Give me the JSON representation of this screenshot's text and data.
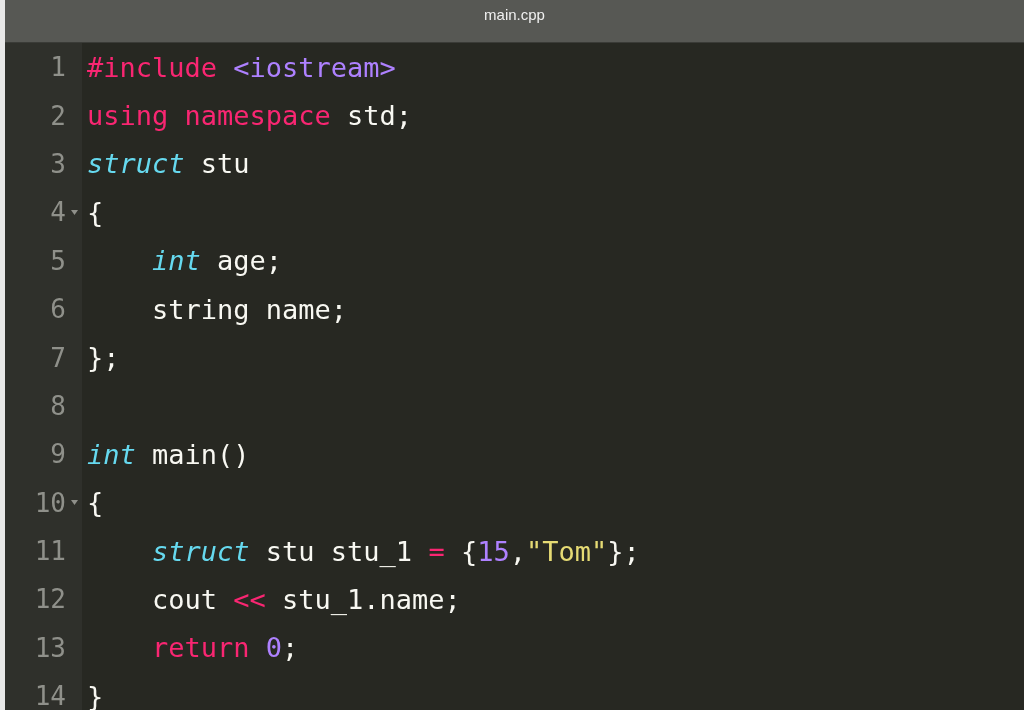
{
  "window": {
    "title": "main.cpp"
  },
  "editor": {
    "lines": [
      {
        "number": "1",
        "foldable": false,
        "indented": false,
        "tokens": [
          {
            "kind": "keyword",
            "text": "#include "
          },
          {
            "kind": "number",
            "text": "<iostream>"
          }
        ]
      },
      {
        "number": "2",
        "foldable": false,
        "indented": false,
        "tokens": [
          {
            "kind": "keyword",
            "text": "using namespace "
          },
          {
            "kind": "plain",
            "text": "std;"
          }
        ]
      },
      {
        "number": "3",
        "foldable": false,
        "indented": false,
        "tokens": [
          {
            "kind": "type",
            "text": "struct"
          },
          {
            "kind": "plain",
            "text": " stu"
          }
        ]
      },
      {
        "number": "4",
        "foldable": true,
        "indented": false,
        "tokens": [
          {
            "kind": "plain",
            "text": "{"
          }
        ]
      },
      {
        "number": "5",
        "foldable": false,
        "indented": true,
        "tokens": [
          {
            "kind": "type",
            "text": "int"
          },
          {
            "kind": "plain",
            "text": " age;"
          }
        ]
      },
      {
        "number": "6",
        "foldable": false,
        "indented": true,
        "tokens": [
          {
            "kind": "plain",
            "text": "string name;"
          }
        ]
      },
      {
        "number": "7",
        "foldable": false,
        "indented": false,
        "tokens": [
          {
            "kind": "plain",
            "text": "};"
          }
        ]
      },
      {
        "number": "8",
        "foldable": false
      },
      {
        "number": "9",
        "foldable": false,
        "indented": false,
        "tokens": [
          {
            "kind": "type",
            "text": "int"
          },
          {
            "kind": "plain",
            "text": " main()"
          }
        ]
      },
      {
        "number": "10",
        "foldable": true,
        "indented": false,
        "tokens": [
          {
            "kind": "plain",
            "text": "{"
          }
        ]
      },
      {
        "number": "11",
        "foldable": false,
        "indented": true,
        "tokens": [
          {
            "kind": "type",
            "text": "struct"
          },
          {
            "kind": "plain",
            "text": " stu stu_1 "
          },
          {
            "kind": "keyword",
            "text": "="
          },
          {
            "kind": "plain",
            "text": " {"
          },
          {
            "kind": "number",
            "text": "15"
          },
          {
            "kind": "plain",
            "text": ","
          },
          {
            "kind": "string",
            "text": "\"Tom\""
          },
          {
            "kind": "plain",
            "text": "};"
          }
        ]
      },
      {
        "number": "12",
        "foldable": false,
        "indented": true,
        "tokens": [
          {
            "kind": "plain",
            "text": "cout "
          },
          {
            "kind": "keyword",
            "text": "<<"
          },
          {
            "kind": "plain",
            "text": " stu_1.name;"
          }
        ]
      },
      {
        "number": "13",
        "foldable": false,
        "indented": true,
        "tokens": [
          {
            "kind": "keyword",
            "text": "return "
          },
          {
            "kind": "number",
            "text": "0"
          },
          {
            "kind": "plain",
            "text": ";"
          }
        ]
      },
      {
        "number": "14",
        "foldable": false,
        "indented": false,
        "tokens": [
          {
            "kind": "plain",
            "text": "}"
          }
        ]
      }
    ]
  }
}
